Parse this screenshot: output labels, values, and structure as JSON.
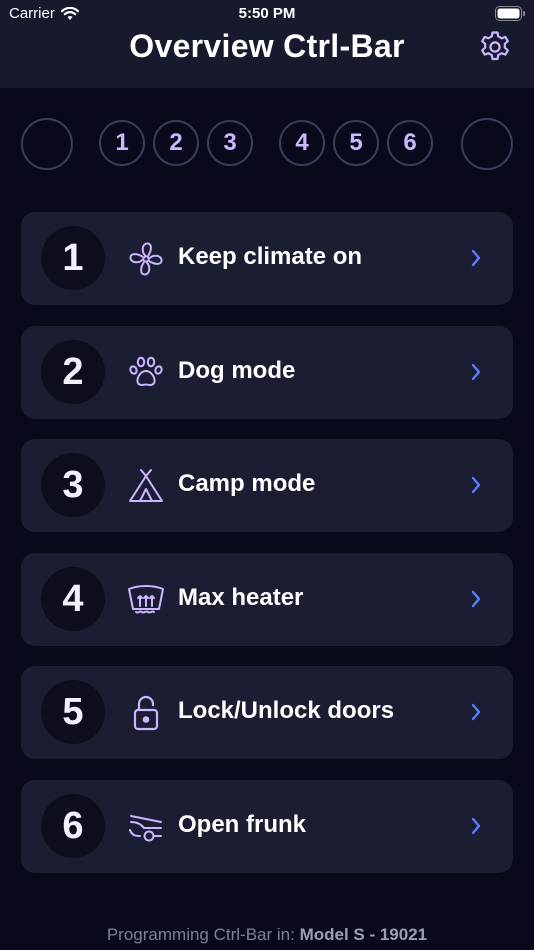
{
  "status_bar": {
    "carrier": "Carrier",
    "time": "5:50 PM"
  },
  "header": {
    "title": "Overview Ctrl-Bar",
    "settings_icon": "gear-icon"
  },
  "slot_row": [
    "",
    "1",
    "2",
    "3",
    "4",
    "5",
    "6",
    ""
  ],
  "items": [
    {
      "number": "1",
      "label": "Keep climate on",
      "icon": "fan-icon"
    },
    {
      "number": "2",
      "label": "Dog mode",
      "icon": "paw-icon"
    },
    {
      "number": "3",
      "label": "Camp mode",
      "icon": "tent-icon"
    },
    {
      "number": "4",
      "label": "Max heater",
      "icon": "defrost-heater-icon"
    },
    {
      "number": "5",
      "label": "Lock/Unlock doors",
      "icon": "lock-icon"
    },
    {
      "number": "6",
      "label": "Open frunk",
      "icon": "frunk-icon"
    }
  ],
  "footer": {
    "prefix": "Programming Ctrl-Bar in:",
    "vehicle": "Model S - 19021"
  },
  "colors": {
    "accent": "#cbb6ff",
    "chevron": "#5b7cff",
    "card": "#1b1d33",
    "background": "#080a1b"
  }
}
